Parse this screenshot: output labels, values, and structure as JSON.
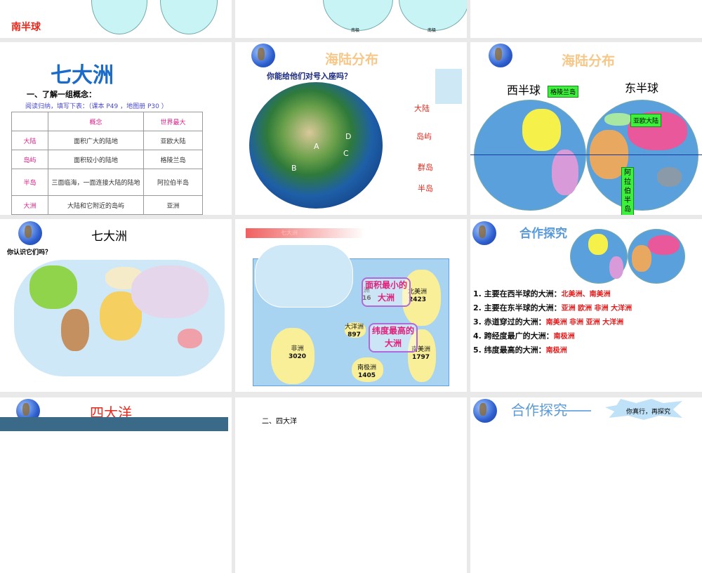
{
  "slides": [
    {
      "id": "s-top-left",
      "text": "南半球"
    },
    {
      "id": "s-top-mid",
      "labels": [
        "南极",
        "南极"
      ]
    },
    {
      "id": "s-qidazhou-table",
      "title": "七大洲",
      "heading": "一、了解一组概念：",
      "instruction": "阅读归纳，填写下表：（课本 P49 ，地图册 P30 ）",
      "table": {
        "headers": [
          "",
          "概念",
          "世界最大"
        ],
        "rows": [
          [
            "大陆",
            "面积广大的陆地",
            "亚欧大陆"
          ],
          [
            "岛屿",
            "面积较小的陆地",
            "格陵兰岛"
          ],
          [
            "半岛",
            "三面临海，一面连接大陆的陆地",
            "阿拉伯半岛"
          ],
          [
            "大洲",
            "大陆和它附近的岛屿",
            "亚洲"
          ]
        ]
      }
    },
    {
      "id": "s-haelu-1",
      "title": "海陆分布",
      "question": "你能给他们对号入座吗？",
      "markers": [
        "A",
        "B",
        "C",
        "D"
      ],
      "terms": [
        "大陆",
        "岛屿",
        "群岛",
        "半岛"
      ]
    },
    {
      "id": "s-haelu-2",
      "title": "海陆分布",
      "west": "西半球",
      "east": "东半球",
      "tags": [
        "格陵兰岛",
        "亚欧大陆",
        "阿拉伯半岛"
      ]
    },
    {
      "id": "s-qidazhou-map",
      "title": "七大洲",
      "question": "你认识它们吗？"
    },
    {
      "id": "s-area",
      "header": "七大洲",
      "continents": [
        {
          "name": "北美洲",
          "area": "2423"
        },
        {
          "name": "大洋洲",
          "area": "897"
        },
        {
          "name": "非洲",
          "area": "3020"
        },
        {
          "name": "南美洲",
          "area": "1797"
        },
        {
          "name": "南极洲",
          "area": "1405"
        },
        {
          "name": "洲",
          "area": "16"
        }
      ],
      "bubbles": [
        "面积最小的大洲",
        "纬度最高的大洲"
      ]
    },
    {
      "id": "s-hezuo",
      "title": "合作探究",
      "questions": [
        {
          "q": "1. 主要在西半球的大洲：",
          "a": "北美洲、南美洲"
        },
        {
          "q": "2. 主要在东半球的大洲：",
          "a": "亚洲  欧洲  非洲  大洋洲"
        },
        {
          "q": "3. 赤道穿过的大洲：",
          "a": "南美洲   非洲   亚洲   大洋洲"
        },
        {
          "q": "4. 跨经度最广的大洲：",
          "a": "南极洲"
        },
        {
          "q": "5. 纬度最高的大洲：",
          "a": "南极洲"
        }
      ]
    },
    {
      "id": "s-sidayang",
      "title": "四大洋"
    },
    {
      "id": "s-sidayang-2",
      "heading": "二、四大洋"
    },
    {
      "id": "s-hezuo-2",
      "title": "合作探究",
      "starburst": "你真行，再探究"
    }
  ]
}
